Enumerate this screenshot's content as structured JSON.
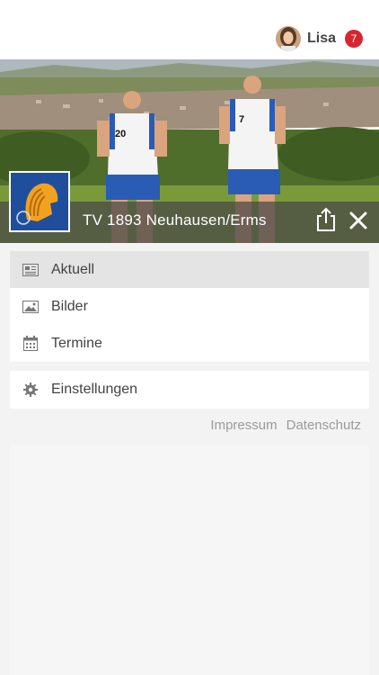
{
  "header": {
    "user_name": "Lisa",
    "notification_count": "7",
    "avatar_icon": "user-avatar"
  },
  "club": {
    "name": "TV 1893 Neuhausen/Erms",
    "logo_icon": "club-crest"
  },
  "menu_primary": [
    {
      "label": "Aktuell",
      "icon": "newspaper-icon",
      "active": true
    },
    {
      "label": "Bilder",
      "icon": "image-icon",
      "active": false
    },
    {
      "label": "Termine",
      "icon": "calendar-icon",
      "active": false
    }
  ],
  "menu_secondary": [
    {
      "label": "Einstellungen",
      "icon": "gear-icon"
    }
  ],
  "footer_links": {
    "impressum": "Impressum",
    "datenschutz": "Datenschutz"
  },
  "colors": {
    "badge": "#d8262e",
    "titlebar": "#464646",
    "active_item": "#e4e4e4"
  }
}
